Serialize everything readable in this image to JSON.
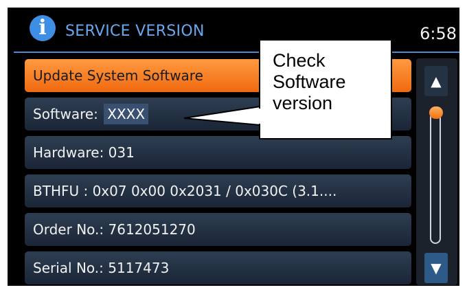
{
  "header": {
    "icon": "info-icon",
    "title": "SERVICE VERSION",
    "clock": "6:58"
  },
  "list": {
    "items": [
      {
        "label": "Update System Software",
        "selected": true
      },
      {
        "label": "Software:",
        "value": "XXXX"
      },
      {
        "label": "Hardware: 031"
      },
      {
        "label": "BTHFU : 0x07 0x00 0x2031 / 0x030C (3.1...."
      },
      {
        "label": "Order No.: 7612051270"
      },
      {
        "label": "Serial No.: 5117473"
      }
    ]
  },
  "scrollbar": {
    "up_icon": "arrow-up-icon",
    "down_icon": "arrow-down-icon",
    "position": 0
  },
  "callout": {
    "lines": [
      "Check",
      "Software",
      "version"
    ]
  },
  "colors": {
    "accent": "#f47b20",
    "title": "#6aa8ee",
    "background": "#000000"
  }
}
